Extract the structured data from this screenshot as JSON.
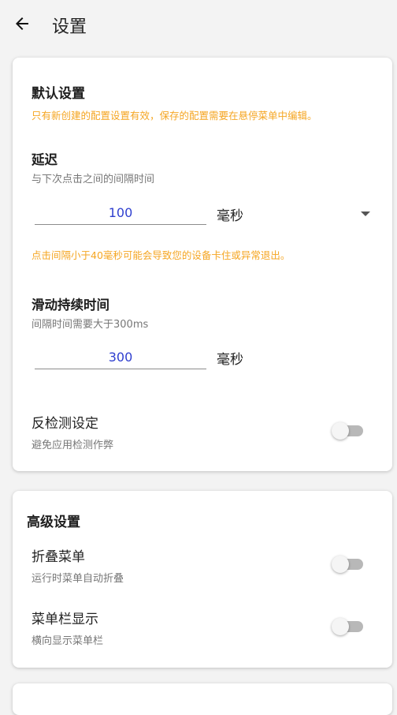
{
  "header": {
    "title": "设置",
    "back_icon": "arrow-left-icon"
  },
  "default_settings": {
    "title": "默认设置",
    "note": "只有新创建的配置设置有效，保存的配置需要在悬停菜单中编辑。",
    "delay": {
      "label": "延迟",
      "description": "与下次点击之间的间隔时间",
      "value": "100",
      "unit": "毫秒",
      "warning": "点击间隔小于40毫秒可能会导致您的设备卡住或异常退出。"
    },
    "swipe_duration": {
      "label": "滑动持续时间",
      "description": "间隔时间需要大于300ms",
      "value": "300",
      "unit": "毫秒"
    },
    "anti_detect": {
      "label": "反检测设定",
      "description": "避免应用检测作弊",
      "enabled": false
    }
  },
  "advanced_settings": {
    "title": "高级设置",
    "fold_menu": {
      "label": "折叠菜单",
      "description": "运行时菜单自动折叠",
      "enabled": false
    },
    "menu_bar": {
      "label": "菜单栏显示",
      "description": "横向显示菜单栏",
      "enabled": false
    }
  },
  "colors": {
    "accent_input": "#2f3fcf",
    "warning": "#f5a623",
    "switch_off_track": "#b8b8b8"
  }
}
